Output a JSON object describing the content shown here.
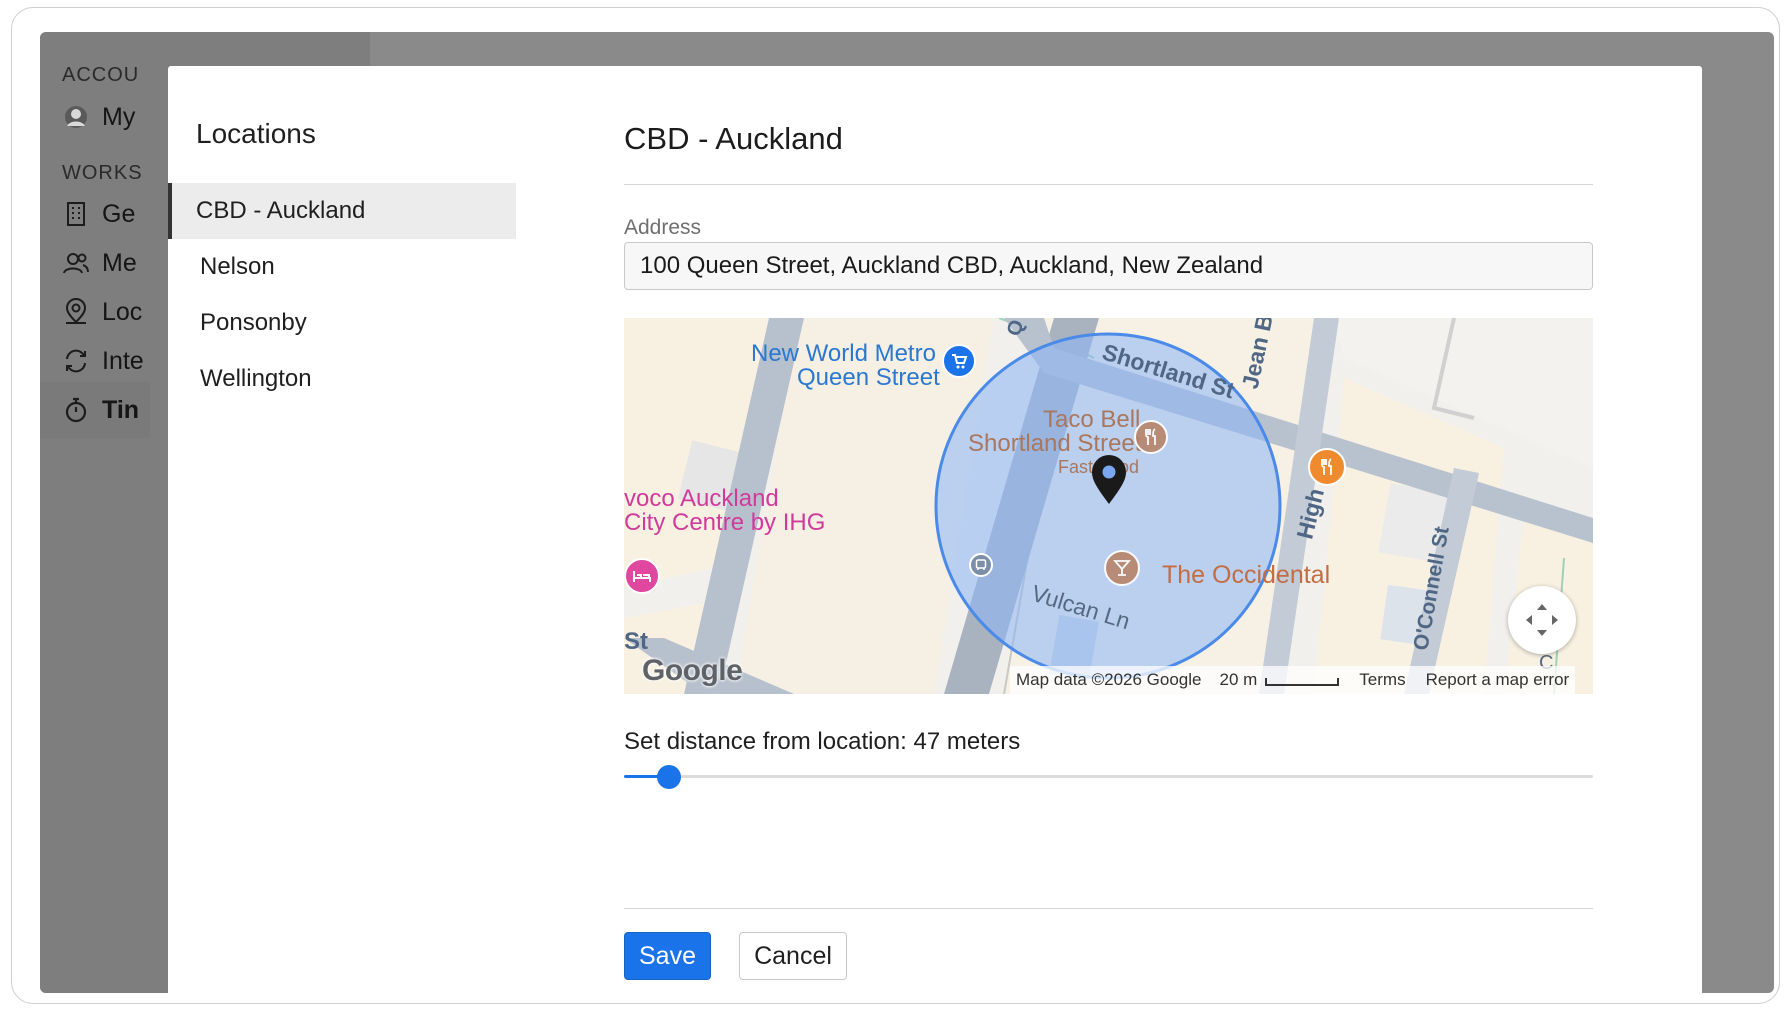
{
  "background_sidebar": {
    "section_account": "ACCOU",
    "section_workspace": "WORKS",
    "items": [
      {
        "label": "My",
        "icon": "avatar-icon"
      },
      {
        "label": "Ge",
        "icon": "building-icon"
      },
      {
        "label": "Me",
        "icon": "members-icon"
      },
      {
        "label": "Loc",
        "icon": "location-icon"
      },
      {
        "label": "Inte",
        "icon": "sync-icon"
      },
      {
        "label": "Tin",
        "icon": "timer-icon",
        "active": true
      }
    ]
  },
  "locations": {
    "title": "Locations",
    "items": [
      "CBD - Auckland",
      "Nelson",
      "Ponsonby",
      "Wellington"
    ],
    "selected_index": 0
  },
  "detail": {
    "title": "CBD - Auckland",
    "address_label": "Address",
    "address_value": "100 Queen Street, Auckland CBD, Auckland, New Zealand"
  },
  "map": {
    "labels": {
      "new_world_1": "New World Metro",
      "new_world_2": "Queen Street",
      "taco_bell_1": "Taco Bell",
      "taco_bell_2": "Shortland Street",
      "fast_food": "Fast Food",
      "voco_1": "voco Auckland",
      "voco_2": "City Centre by IHG",
      "occidental": "The Occidental",
      "shortland_st": "Shortland St",
      "high_st": "High St",
      "oconnell_st": "O'Connell St",
      "vulcan_ln": "Vulcan Ln",
      "jean": "Jean B",
      "q_label": "Q",
      "st_label": "St",
      "c_label": "C"
    },
    "logo": "Google",
    "attribution": "Map data ©2026 Google",
    "scale_label": "20 m",
    "terms": "Terms",
    "report": "Report a map error",
    "colors": {
      "radius_fill": "#8ab4f8",
      "radius_stroke": "#4a8ae8",
      "road": "#a7b4c5",
      "block": "#f7f0e3"
    }
  },
  "distance": {
    "label": "Set distance from location: 47 meters",
    "value_fraction": 0.046
  },
  "buttons": {
    "save": "Save",
    "cancel": "Cancel"
  }
}
